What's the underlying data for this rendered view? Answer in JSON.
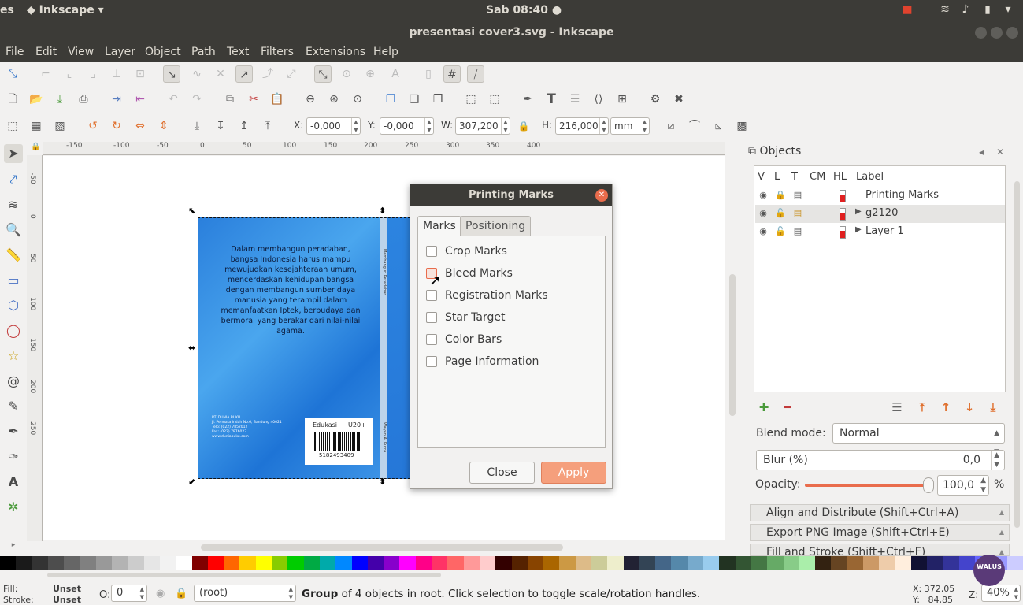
{
  "top_panel": {
    "app_fragment": "es",
    "active_app": "Inkscape",
    "clock": "Sab 08:40"
  },
  "window": {
    "title": "presentasi cover3.svg - Inkscape"
  },
  "menu": [
    "File",
    "Edit",
    "View",
    "Layer",
    "Object",
    "Path",
    "Text",
    "Filters",
    "Extensions",
    "Help"
  ],
  "toolbar": {
    "x_label": "X:",
    "x_value": "-0,000",
    "y_label": "Y:",
    "y_value": "-0,000",
    "w_label": "W:",
    "w_value": "307,200",
    "h_label": "H:",
    "h_value": "216,000",
    "unit": "mm"
  },
  "ruler": {
    "h_ticks": [
      "-150",
      "-100",
      "-50",
      "0",
      "50",
      "100",
      "150",
      "200",
      "250",
      "300",
      "350",
      "400"
    ],
    "v_ticks": [
      "-50",
      "0",
      "50",
      "100",
      "150",
      "200",
      "250"
    ]
  },
  "canvas": {
    "cover_text": "Dalam membangun peradaban, bangsa Indonesia harus mampu mewujudkan kesejahteraan umum, mencerdaskan kehidupan bangsa dengan membangun sumber daya manusia yang terampil dalam memanfaatkan Iptek, berbudaya dan bermoral yang berakar dari nilai-nilai agama.",
    "publisher": "PT. DUNIA BUKU\nJl. Permata Indah No.6, Bandung 40021\nTelp: (022) 7852012\nFax: (022) 7876023\nwww.duniabuku.com",
    "barcode_label_left": "Edukasi",
    "barcode_label_right": "U20+",
    "barcode_number": "5182493409",
    "spine_title": "Membangun Peradaban",
    "spine_author": "Wayan A. Putra"
  },
  "dialog": {
    "title": "Printing Marks",
    "tabs": [
      "Marks",
      "Positioning"
    ],
    "options": [
      {
        "label": "Crop Marks",
        "checked": false
      },
      {
        "label": "Bleed Marks",
        "checked": false
      },
      {
        "label": "Registration Marks",
        "checked": false
      },
      {
        "label": "Star Target",
        "checked": false
      },
      {
        "label": "Color Bars",
        "checked": false
      },
      {
        "label": "Page Information",
        "checked": false
      }
    ],
    "close_label": "Close",
    "apply_label": "Apply"
  },
  "objects_panel": {
    "title": "Objects",
    "columns": [
      "V",
      "L",
      "T",
      "CM",
      "HL",
      "Label"
    ],
    "rows": [
      {
        "label": "Printing Marks",
        "expandable": false,
        "selected": false
      },
      {
        "label": "g2120",
        "expandable": true,
        "selected": true
      },
      {
        "label": "Layer 1",
        "expandable": true,
        "selected": false
      }
    ],
    "blend_label": "Blend mode:",
    "blend_value": "Normal",
    "blur_label": "Blur (%)",
    "blur_value": "0,0",
    "opacity_label": "Opacity:",
    "opacity_value": "100,0",
    "opacity_unit": "%",
    "opacity_fraction": 1.0
  },
  "docked": [
    "Align and Distribute (Shift+Ctrl+A)",
    "Export PNG Image (Shift+Ctrl+E)",
    "Fill and Stroke (Shift+Ctrl+F)"
  ],
  "statusbar": {
    "fill_label": "Fill:",
    "fill_value": "Unset",
    "stroke_label": "Stroke:",
    "stroke_value": "Unset",
    "o_label": "O:",
    "o_value": "0",
    "layer_value": "(root)",
    "message_bold": "Group",
    "message_rest": " of 4 objects in root. Click selection to toggle scale/rotation handles.",
    "x_coord": "X: 372,05",
    "y_coord": "Y:   84,85",
    "z_label": "Z:",
    "zoom": "40%"
  },
  "watermark": "WALUS",
  "palette": [
    "#000000",
    "#1a1a1a",
    "#333333",
    "#4d4d4d",
    "#666666",
    "#808080",
    "#999999",
    "#b3b3b3",
    "#cccccc",
    "#e6e6e6",
    "#f2f2f2",
    "#ffffff",
    "#800000",
    "#ff0000",
    "#ff6600",
    "#ffcc00",
    "#ffff00",
    "#88cc00",
    "#00cc00",
    "#00aa44",
    "#00aaaa",
    "#0088ff",
    "#0000ff",
    "#4400aa",
    "#8800cc",
    "#ff00ff",
    "#ff0088",
    "#ff3366",
    "#ff6666",
    "#ff9999",
    "#ffcccc",
    "#330000",
    "#552200",
    "#884400",
    "#aa6600",
    "#cc9944",
    "#ddbb88",
    "#cccc99",
    "#eeeecc",
    "#222233",
    "#334455",
    "#446688",
    "#5588aa",
    "#77aacc",
    "#99ccee",
    "#223322",
    "#335533",
    "#447744",
    "#66aa66",
    "#88cc88",
    "#aaeeaa",
    "#332211",
    "#664422",
    "#996633",
    "#cc9966",
    "#eeccaa",
    "#ffeedd",
    "#111133",
    "#222266",
    "#333399",
    "#4444cc",
    "#6666ff",
    "#9999ff",
    "#ccccff"
  ]
}
